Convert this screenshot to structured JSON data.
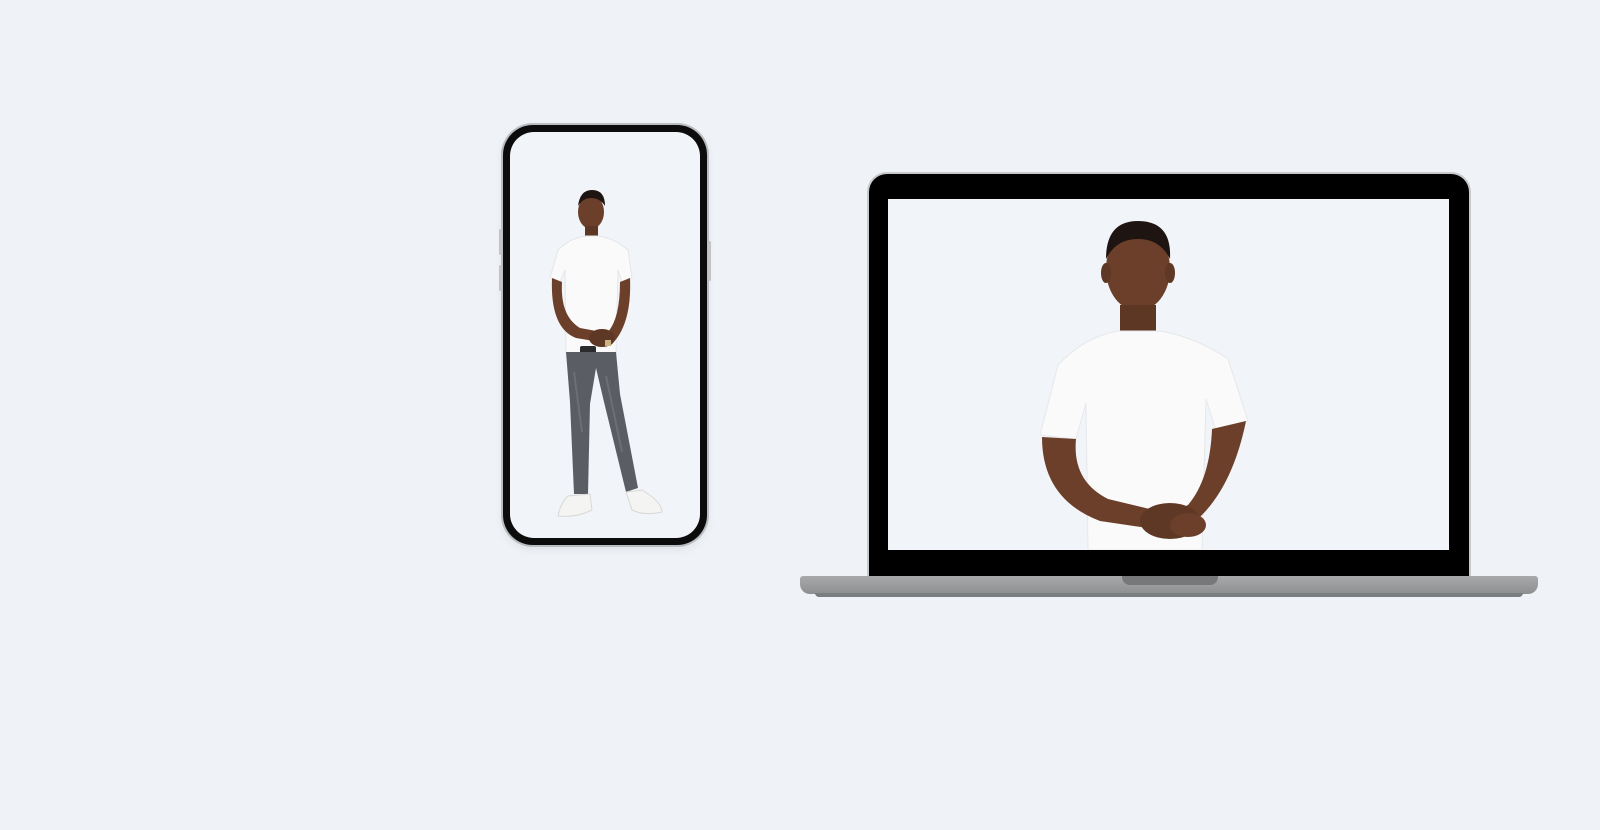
{
  "devices": {
    "phone": {
      "screen_content": "person-full-body",
      "screen_background": "#f1f4f8"
    },
    "laptop": {
      "screen_content": "person-upper-body",
      "screen_background": "#f1f4f8"
    }
  },
  "colors": {
    "page_background": "#eff3f7",
    "bezel": "#0c0c0c",
    "laptop_base": "#9a9b9d",
    "skin": "#6b3f2a",
    "shirt": "#fafafa",
    "jeans": "#5a5d63",
    "hair": "#1e1512"
  },
  "icons": [
    "phone-device",
    "laptop-device"
  ]
}
